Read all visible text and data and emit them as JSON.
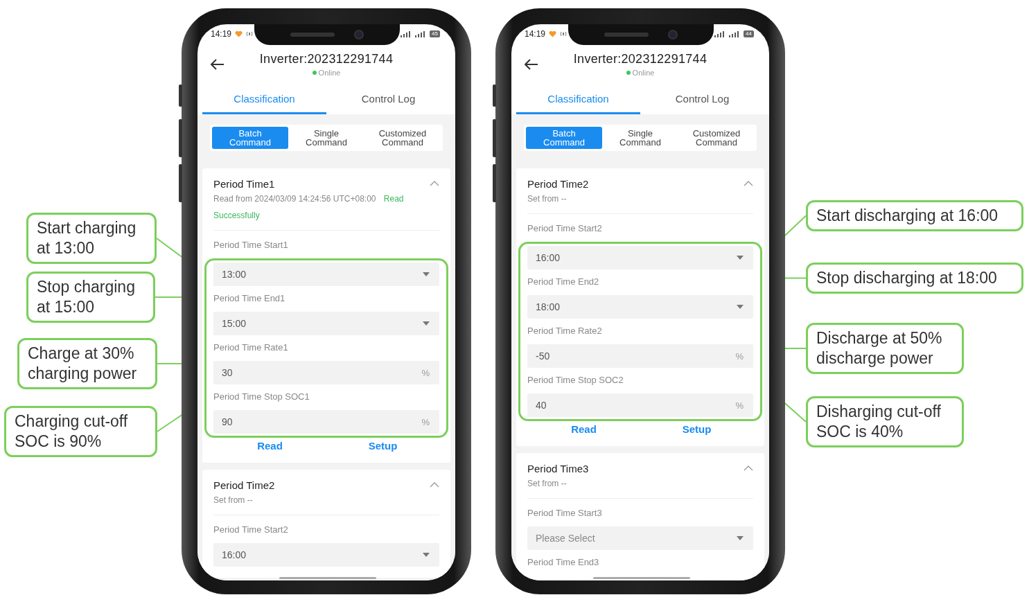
{
  "phones": [
    {
      "status_time": "14:19",
      "battery": "45",
      "title": "Inverter:202312291744",
      "status": "Online",
      "tabs": [
        {
          "label": "Classification",
          "selected": true
        },
        {
          "label": "Control Log",
          "selected": false
        }
      ],
      "command_tabs": [
        {
          "label": "Batch Command",
          "selected": true
        },
        {
          "label": "Single Command",
          "selected": false
        },
        {
          "label": "Customized Command",
          "selected": false
        }
      ],
      "sections": [
        {
          "title": "Period Time1",
          "expanded": true,
          "info": "Read from 2024/03/09 14:24:56 UTC+08:00",
          "info_status": "Read Successfully",
          "highlighted": true,
          "fields": [
            {
              "label": "Period Time Start1",
              "kind": "select",
              "value": "13:00"
            },
            {
              "label": "Period Time End1",
              "kind": "select",
              "value": "15:00"
            },
            {
              "label": "Period Time Rate1",
              "kind": "number",
              "value": "30",
              "unit": "%"
            },
            {
              "label": "Period Time Stop SOC1",
              "kind": "number",
              "value": "90",
              "unit": "%"
            }
          ],
          "actions": [
            "Read",
            "Setup"
          ]
        },
        {
          "title": "Period Time2",
          "expanded": true,
          "info": "Set from --",
          "highlighted": false,
          "fields": [
            {
              "label": "Period Time Start2",
              "kind": "select",
              "value": "16:00"
            }
          ]
        }
      ],
      "callouts": [
        "Start charging at 13:00",
        "Stop charging at 15:00",
        "Charge at 30% charging power",
        "Charging cut-off SOC is 90%"
      ]
    },
    {
      "status_time": "14:19",
      "battery": "44",
      "title": "Inverter:202312291744",
      "status": "Online",
      "tabs": [
        {
          "label": "Classification",
          "selected": true
        },
        {
          "label": "Control Log",
          "selected": false
        }
      ],
      "command_tabs": [
        {
          "label": "Batch Command",
          "selected": true
        },
        {
          "label": "Single Command",
          "selected": false
        },
        {
          "label": "Customized Command",
          "selected": false
        }
      ],
      "sections": [
        {
          "title": "Period Time2",
          "expanded": true,
          "info": "Set from --",
          "highlighted": true,
          "fields": [
            {
              "label": "Period Time Start2",
              "kind": "select",
              "value": "16:00"
            },
            {
              "label": "Period Time End2",
              "kind": "select",
              "value": "18:00"
            },
            {
              "label": "Period Time Rate2",
              "kind": "number",
              "value": "-50",
              "unit": "%"
            },
            {
              "label": "Period Time Stop SOC2",
              "kind": "number",
              "value": "40",
              "unit": "%"
            }
          ],
          "actions": [
            "Read",
            "Setup"
          ]
        },
        {
          "title": "Period Time3",
          "expanded": true,
          "info": "Set from --",
          "highlighted": false,
          "fields": [
            {
              "label": "Period Time Start3",
              "kind": "select",
              "placeholder": "Please Select"
            },
            {
              "label": "Period Time End3",
              "kind": "label"
            }
          ]
        }
      ],
      "callouts": [
        "Start discharging at 16:00",
        "Stop discharging at 18:00",
        "Discharge at 50% discharge power",
        "Disharging cut-off SOC is 40%"
      ]
    }
  ]
}
